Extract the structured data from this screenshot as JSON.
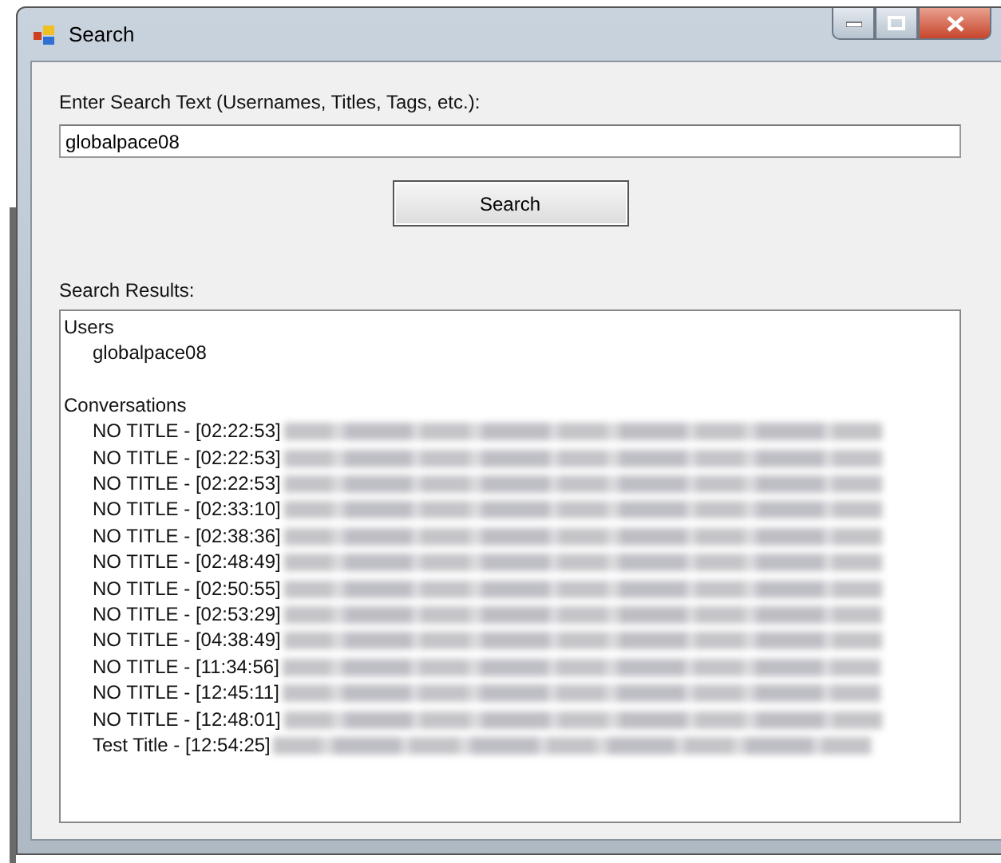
{
  "window": {
    "title": "Search"
  },
  "search": {
    "label": "Enter Search Text (Usernames, Titles, Tags, etc.):",
    "value": "globalpace08",
    "button": "Search"
  },
  "results": {
    "label": "Search Results:",
    "groups": [
      {
        "heading": "Users",
        "items": [
          {
            "text": "globalpace08",
            "redacted": false
          }
        ]
      },
      {
        "heading": "Conversations",
        "items": [
          {
            "text": "NO TITLE - [02:22:53]",
            "redacted": true
          },
          {
            "text": "NO TITLE - [02:22:53]",
            "redacted": true
          },
          {
            "text": "NO TITLE - [02:22:53]",
            "redacted": true
          },
          {
            "text": "NO TITLE - [02:33:10]",
            "redacted": true
          },
          {
            "text": "NO TITLE - [02:38:36]",
            "redacted": true
          },
          {
            "text": "NO TITLE - [02:48:49]",
            "redacted": true
          },
          {
            "text": "NO TITLE - [02:50:55]",
            "redacted": true
          },
          {
            "text": "NO TITLE - [02:53:29]",
            "redacted": true
          },
          {
            "text": "NO TITLE - [04:38:49]",
            "redacted": true
          },
          {
            "text": "NO TITLE - [11:34:56]",
            "redacted": true
          },
          {
            "text": "NO TITLE - [12:45:11]",
            "redacted": true
          },
          {
            "text": "NO TITLE - [12:48:01]",
            "redacted": true
          },
          {
            "text": "Test Title - [12:54:25]",
            "redacted": true
          }
        ]
      }
    ]
  }
}
